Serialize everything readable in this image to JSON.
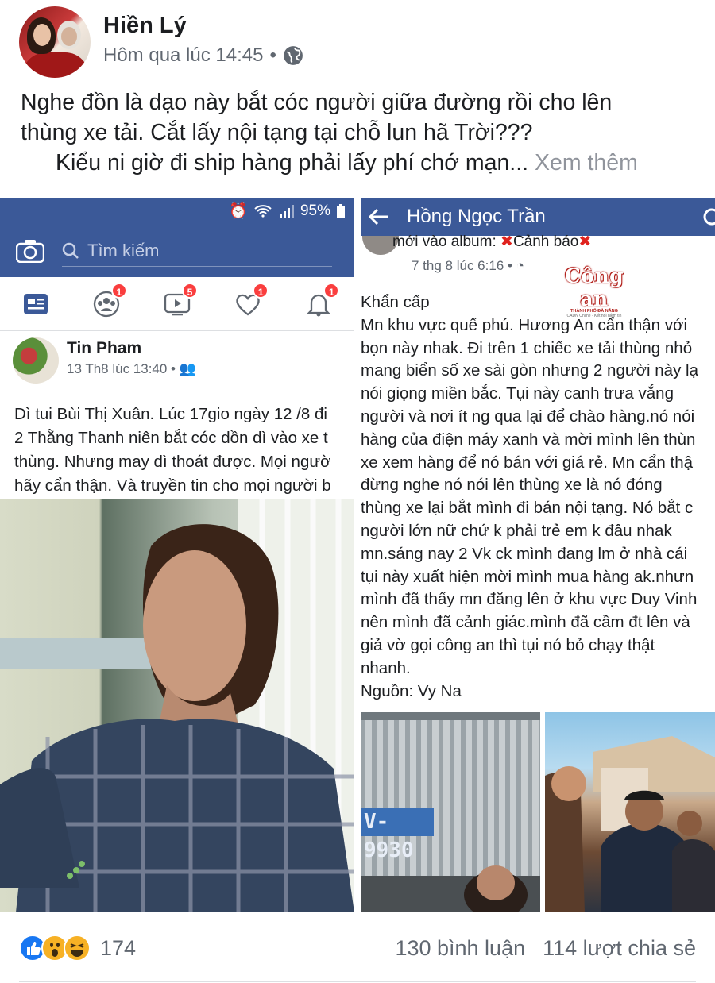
{
  "post": {
    "author": "Hiền Lý",
    "timestamp": "Hôm qua lúc 14:45",
    "privacy_icon": "globe-icon",
    "caption_line1": "Nghe đồn là dạo này bắt cóc người giữa đường rồi cho lên",
    "caption_line2": "thùng xe tải. Cắt lấy nội tạng tại chỗ lun hã Trời???",
    "caption_line3": "Kiểu ni giờ đi ship hàng phải lấy phí chớ mạn...",
    "see_more": "Xem thêm"
  },
  "left_shot": {
    "status_battery": "95%",
    "search_placeholder": "Tìm kiếm",
    "nav_badges": [
      "1",
      "5",
      "1",
      "1"
    ],
    "author": "Tin Pham",
    "timestamp": "13 Th8 lúc 13:40 •",
    "text_lines": [
      "Dì tui Bùi Thị Xuân. Lúc 17gio ngày 12 /8 đi",
      "2 Thằng Thanh niên bắt cóc dồn dì vào xe t",
      "thùng. Nhưng may dì thoát được. Mọi ngườ",
      "hãy cẩn thận. Và truyền tin cho mọi người b"
    ]
  },
  "right_shot": {
    "title": "Hồng Ngọc Trần",
    "cut_line": "mới vào album:",
    "cut_line_warning": "Cảnh báo",
    "timestamp": "7 thg 8 lúc 6:16 •",
    "watermark_main": "Công an",
    "watermark_sub": "THÀNH PHỐ ĐÀ NẴNG",
    "watermark_sub2": "CADN Online · Kết nối niềm tin",
    "text_lines": [
      "Khẩn cấp",
      "Mn khu vực quế phú. Hương An  cẩn thận với",
      "bọn này nhak. Đi trên 1 chiếc xe tải thùng nhỏ",
      "mang biển số xe sài gòn nhưng 2 người này lạ",
      "nói giọng miền bắc. Tụi này canh trưa vắng",
      "người và nơi ít ng qua lại để chào hàng.nó nói",
      "hàng của điện máy xanh và mời mình lên thùn",
      "xe xem hàng để nó bán với giá rẻ. Mn cẩn thậ",
      "đừng nghe nó nói lên thùng xe là nó đóng",
      "thùng xe lại bắt mình đi bán nội tạng. Nó bắt c",
      "người lớn nữ chứ k phải trẻ em k đâu nhak",
      "mn.sáng nay 2 Vk ck mình đang lm ở nhà cái",
      "tụi này xuất hiện mời mình mua hàng ak.nhưn",
      "mình đã thấy mn đăng lên ở khu vực Duy Vinh",
      "nên mình đã cảnh giác.mình đã cầm đt lên và",
      "giả vờ gọi công an thì tụi nó bỏ chạy thật",
      "nhanh.",
      "Nguồn: Vy Na"
    ],
    "plate_text": "V-9930"
  },
  "footer": {
    "reaction_count": "174",
    "comments": "130 bình luận",
    "shares": "114 lượt chia sẻ"
  },
  "colors": {
    "facebook_blue": "#3b5998",
    "text": "#1c1e21",
    "meta_gray": "#606770",
    "badge_red": "#fa3e3e"
  }
}
